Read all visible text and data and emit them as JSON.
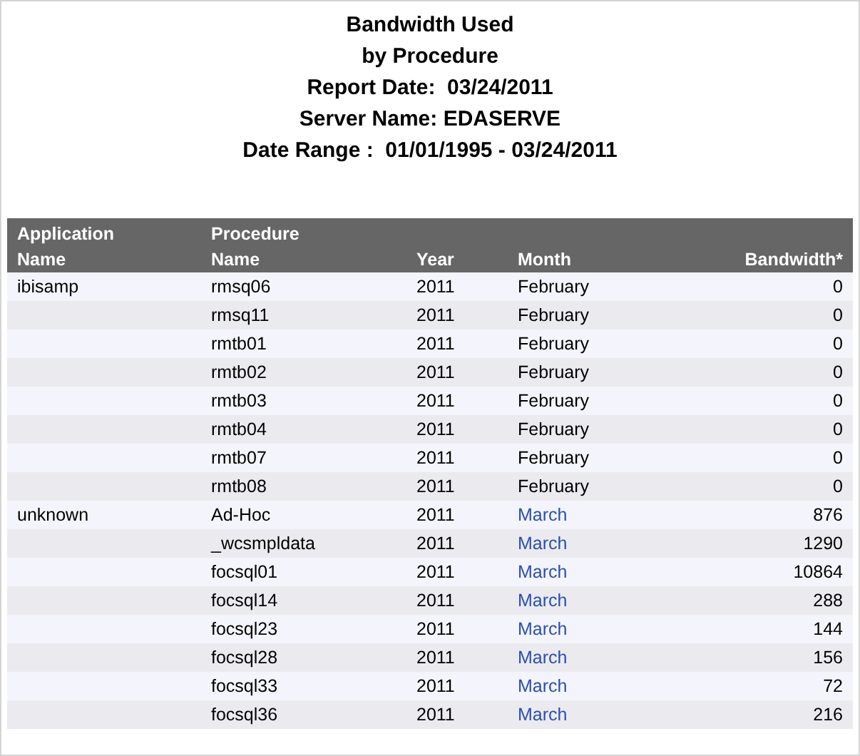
{
  "title_lines": [
    "Bandwidth Used",
    "by Procedure",
    "Report Date:  03/24/2011",
    "Server Name: EDASERVE",
    "Date Range :  01/01/1995 - 03/24/2011"
  ],
  "table": {
    "columns": [
      {
        "lines": [
          "Application",
          "Name"
        ],
        "kind": "text"
      },
      {
        "lines": [
          "Procedure",
          "Name"
        ],
        "kind": "text"
      },
      {
        "lines": [
          "Year"
        ],
        "kind": "text"
      },
      {
        "lines": [
          "Month"
        ],
        "kind": "text"
      },
      {
        "lines": [
          "Bandwidth*"
        ],
        "kind": "numeric"
      }
    ],
    "rows": [
      {
        "application": "ibisamp",
        "procedure": "rmsq06",
        "year": "2011",
        "month": "February",
        "month_link": false,
        "bandwidth": "0"
      },
      {
        "procedure": "rmsq11",
        "year": "2011",
        "month": "February",
        "month_link": false,
        "bandwidth": "0"
      },
      {
        "procedure": "rmtb01",
        "year": "2011",
        "month": "February",
        "month_link": false,
        "bandwidth": "0"
      },
      {
        "procedure": "rmtb02",
        "year": "2011",
        "month": "February",
        "month_link": false,
        "bandwidth": "0"
      },
      {
        "procedure": "rmtb03",
        "year": "2011",
        "month": "February",
        "month_link": false,
        "bandwidth": "0"
      },
      {
        "procedure": "rmtb04",
        "year": "2011",
        "month": "February",
        "month_link": false,
        "bandwidth": "0"
      },
      {
        "procedure": "rmtb07",
        "year": "2011",
        "month": "February",
        "month_link": false,
        "bandwidth": "0"
      },
      {
        "procedure": "rmtb08",
        "year": "2011",
        "month": "February",
        "month_link": false,
        "bandwidth": "0"
      },
      {
        "application": "unknown",
        "procedure": "Ad-Hoc",
        "year": "2011",
        "month": "March",
        "month_link": true,
        "bandwidth": "876"
      },
      {
        "procedure": "_wcsmpldata",
        "year": "2011",
        "month": "March",
        "month_link": true,
        "bandwidth": "1290"
      },
      {
        "procedure": "focsql01",
        "year": "2011",
        "month": "March",
        "month_link": true,
        "bandwidth": "10864"
      },
      {
        "procedure": "focsql14",
        "year": "2011",
        "month": "March",
        "month_link": true,
        "bandwidth": "288"
      },
      {
        "procedure": "focsql23",
        "year": "2011",
        "month": "March",
        "month_link": true,
        "bandwidth": "144"
      },
      {
        "procedure": "focsql28",
        "year": "2011",
        "month": "March",
        "month_link": true,
        "bandwidth": "156"
      },
      {
        "procedure": "focsql33",
        "year": "2011",
        "month": "March",
        "month_link": true,
        "bandwidth": "72"
      },
      {
        "procedure": "focsql36",
        "year": "2011",
        "month": "March",
        "month_link": true,
        "bandwidth": "216"
      }
    ]
  }
}
